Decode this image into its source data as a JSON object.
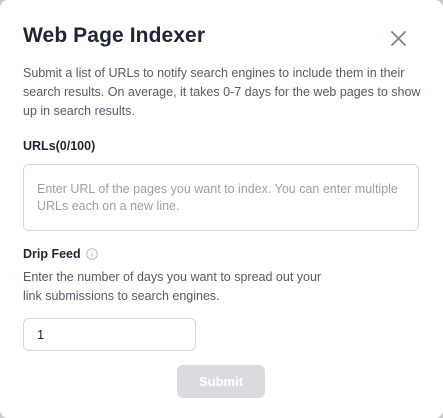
{
  "dialog": {
    "title": "Web Page Indexer",
    "close_icon": "close-icon",
    "description": "Submit a list of URLs to notify search engines to include them in their search results. On average, it takes 0-7 days for the web pages to show up in search results."
  },
  "urls": {
    "label": "URLs(0/100)",
    "value": "",
    "placeholder": "Enter URL of the pages you want to index. You can enter multiple URLs each on a new line."
  },
  "drip_feed": {
    "label": "Drip Feed",
    "info_icon": "info-icon",
    "description": "Enter the number of days you want to spread out your link submissions to search engines.",
    "value": "1"
  },
  "submit": {
    "label": "Submit",
    "disabled": true
  },
  "colors": {
    "title": "#1f2533",
    "text_muted": "#555b66",
    "border": "#d3d6dc",
    "button_disabled_bg": "#d9dbde"
  }
}
